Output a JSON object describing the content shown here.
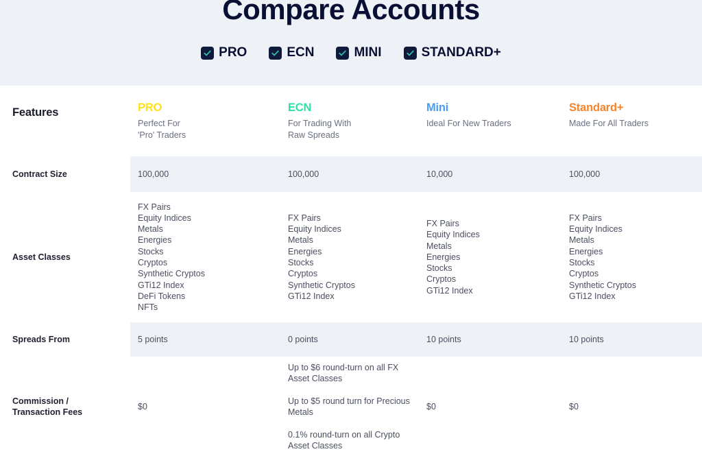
{
  "header": {
    "title": "Compare Accounts",
    "filters": [
      {
        "label": "PRO",
        "checked": true,
        "icon": "check-icon"
      },
      {
        "label": "ECN",
        "checked": true,
        "icon": "check-icon"
      },
      {
        "label": "MINI",
        "checked": true,
        "icon": "check-icon"
      },
      {
        "label": "STANDARD+",
        "checked": true,
        "icon": "check-icon"
      }
    ]
  },
  "colors": {
    "band_background": "#eef1f5",
    "stripe_background": "#eef1f5",
    "title": "#0a1034",
    "checkbox_box": "#0f1a3c",
    "checkbox_check": "#2ec4a6",
    "pro": "#ffe01b",
    "ecn": "#2ce0a8",
    "mini": "#4a9df5",
    "standard": "#f5842a",
    "body_text": "#4a4f60",
    "feature_text": "#202230"
  },
  "table": {
    "feature_column_header": "Features",
    "plans": [
      {
        "name": "PRO",
        "tagline": "Perfect For\n'Pro' Traders",
        "tagline_lines": [
          "Perfect For",
          "'Pro' Traders"
        ],
        "color": "#ffe01b"
      },
      {
        "name": "ECN",
        "tagline_lines": [
          "For Trading With",
          "Raw Spreads"
        ],
        "color": "#2ce0a8"
      },
      {
        "name": "Mini",
        "tagline_lines": [
          "Ideal For New Traders"
        ],
        "color": "#4a9df5"
      },
      {
        "name": "Standard+",
        "tagline_lines": [
          "Made For All Traders"
        ],
        "color": "#f5842a"
      }
    ],
    "rows": [
      {
        "feature": "Contract Size",
        "striped": true,
        "values": [
          "100,000",
          "100,000",
          "10,000",
          "100,000"
        ]
      },
      {
        "feature": "Asset Classes",
        "striped": false,
        "lists": [
          [
            "FX Pairs",
            "Equity Indices",
            "Metals",
            "Energies",
            "Stocks",
            "Cryptos",
            "Synthetic Cryptos",
            "GTi12 Index",
            "DeFi Tokens",
            "NFTs"
          ],
          [
            "FX Pairs",
            "Equity Indices",
            "Metals",
            "Energies",
            "Stocks",
            "Cryptos",
            "Synthetic Cryptos",
            "GTi12 Index"
          ],
          [
            "FX Pairs",
            "Equity Indices",
            "Metals",
            "Energies",
            "Stocks",
            "Cryptos",
            "GTi12 Index"
          ],
          [
            "FX Pairs",
            "Equity Indices",
            "Metals",
            "Energies",
            "Stocks",
            "Cryptos",
            "Synthetic Cryptos",
            "GTi12 Index"
          ]
        ]
      },
      {
        "feature": "Spreads From",
        "striped": true,
        "values": [
          "5 points",
          "0 points",
          "10 points",
          "10 points"
        ]
      },
      {
        "feature": "Commission /\nTransaction Fees",
        "feature_lines": [
          "Commission /",
          "Transaction Fees"
        ],
        "striped": false,
        "paragraphs": [
          [
            "$0"
          ],
          [
            "Up to $6 round-turn on all FX Asset Classes",
            "Up to $5 round turn for Precious Metals",
            "0.1% round-turn on all Crypto Asset Classes"
          ],
          [
            "$0"
          ],
          [
            "$0"
          ]
        ]
      }
    ]
  }
}
